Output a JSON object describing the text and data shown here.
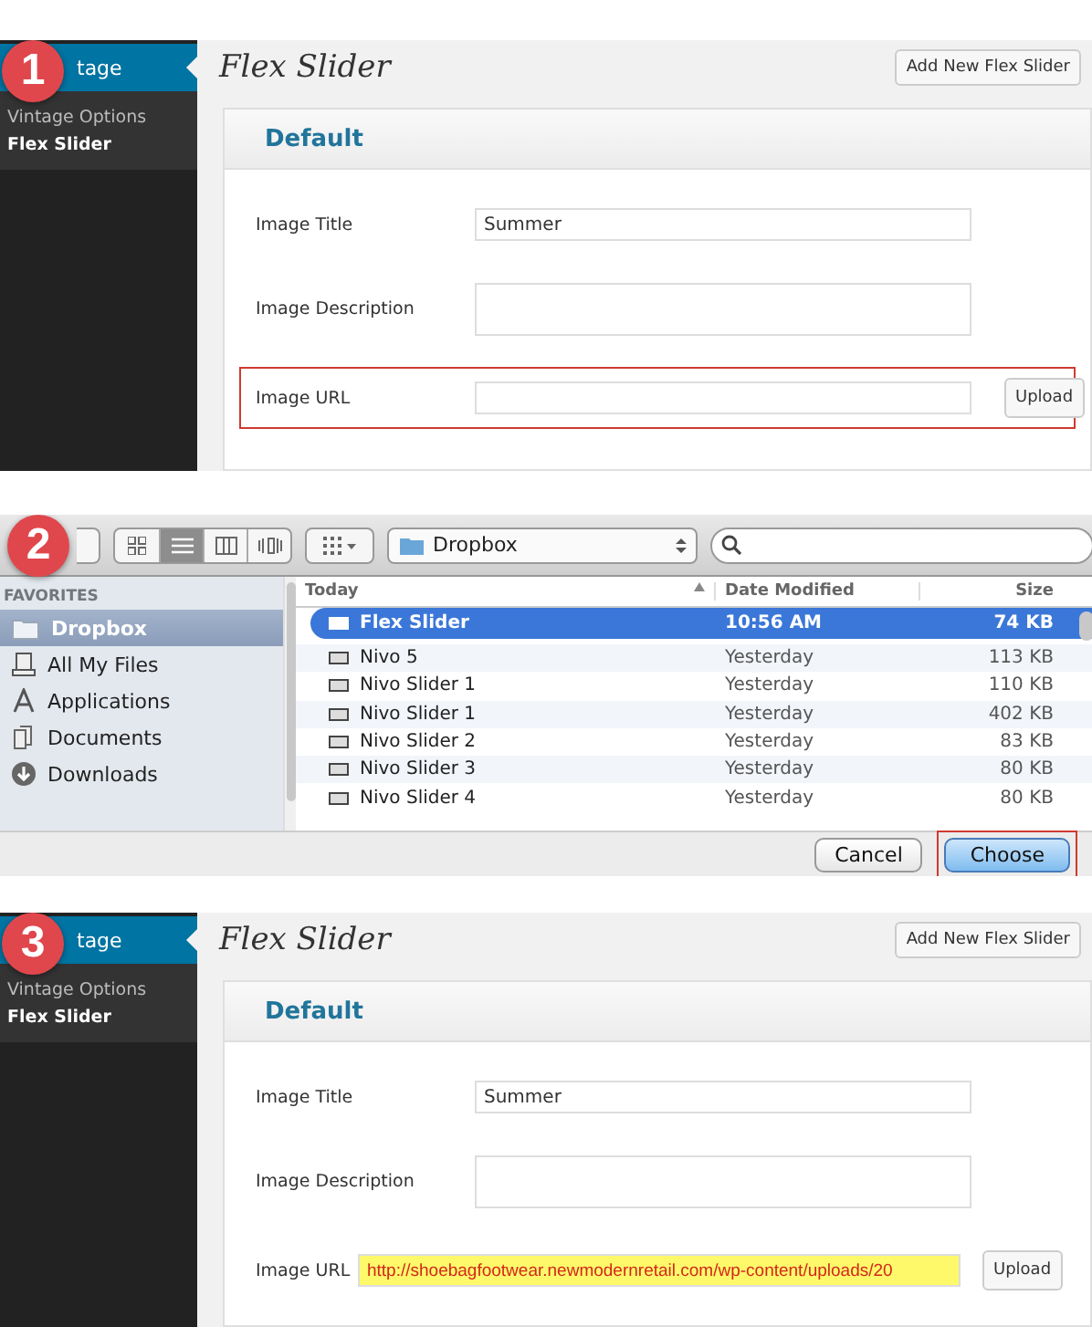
{
  "steps": [
    {
      "kind": "wp",
      "badge": "1",
      "menu_current": "tage",
      "menu_items": [
        {
          "label": "Vintage Options",
          "selected": false
        },
        {
          "label": "Flex Slider",
          "selected": true
        }
      ],
      "page_title": "Flex Slider",
      "add_button": "Add New Flex Slider",
      "box_title": "Default",
      "fields": [
        {
          "kind": "text",
          "label": "Image Title",
          "value": "Summer"
        },
        {
          "kind": "textarea",
          "label": "Image Description"
        },
        {
          "kind": "url",
          "label": "Image URL",
          "button": "Upload",
          "outlined": true,
          "highlighted": false
        }
      ]
    },
    {
      "kind": "finder",
      "badge": "2",
      "views": [
        {
          "selected": false
        },
        {
          "selected": true
        },
        {
          "selected": false
        },
        {
          "selected": false
        }
      ],
      "location": "Dropbox",
      "sidebar_heading": "FAVORITES",
      "places": [
        {
          "label": "Dropbox",
          "selected": true
        },
        {
          "label": "All My Files",
          "selected": false
        },
        {
          "label": "Applications",
          "selected": false
        },
        {
          "label": "Documents",
          "selected": false
        },
        {
          "label": "Downloads",
          "selected": false
        }
      ],
      "columns": [
        "Today",
        "Date Modified",
        "Size"
      ],
      "files": [
        {
          "name": "Flex Slider",
          "date": "10:56 AM",
          "size": "74 KB",
          "selected": true
        },
        {
          "name": "Nivo 5",
          "date": "Yesterday",
          "size": "113 KB",
          "selected": false
        },
        {
          "name": "Nivo Slider 1",
          "date": "Yesterday",
          "size": "110 KB",
          "selected": false
        },
        {
          "name": "Nivo Slider 1",
          "date": "Yesterday",
          "size": "402 KB",
          "selected": false
        },
        {
          "name": "Nivo Slider 2",
          "date": "Yesterday",
          "size": "83 KB",
          "selected": false
        },
        {
          "name": "Nivo Slider 3",
          "date": "Yesterday",
          "size": "80 KB",
          "selected": false
        },
        {
          "name": "Nivo Slider 4",
          "date": "Yesterday",
          "size": "80 KB",
          "selected": false
        }
      ],
      "buttons": [
        {
          "label": "Cancel",
          "default": false,
          "outlined": false
        },
        {
          "label": "Choose",
          "default": true,
          "outlined": true
        }
      ]
    },
    {
      "kind": "wp",
      "badge": "3",
      "menu_current": "tage",
      "menu_items": [
        {
          "label": "Vintage Options",
          "selected": false
        },
        {
          "label": "Flex Slider",
          "selected": true
        }
      ],
      "page_title": "Flex Slider",
      "add_button": "Add New Flex Slider",
      "box_title": "Default",
      "fields": [
        {
          "kind": "text",
          "label": "Image Title",
          "value": "Summer"
        },
        {
          "kind": "textarea",
          "label": "Image Description"
        },
        {
          "kind": "url",
          "label": "Image URL",
          "value": "http://shoebagfootwear.newmodernretail.com/wp-content/uploads/20",
          "button": "Upload",
          "outlined": false,
          "highlighted": true
        }
      ]
    }
  ]
}
